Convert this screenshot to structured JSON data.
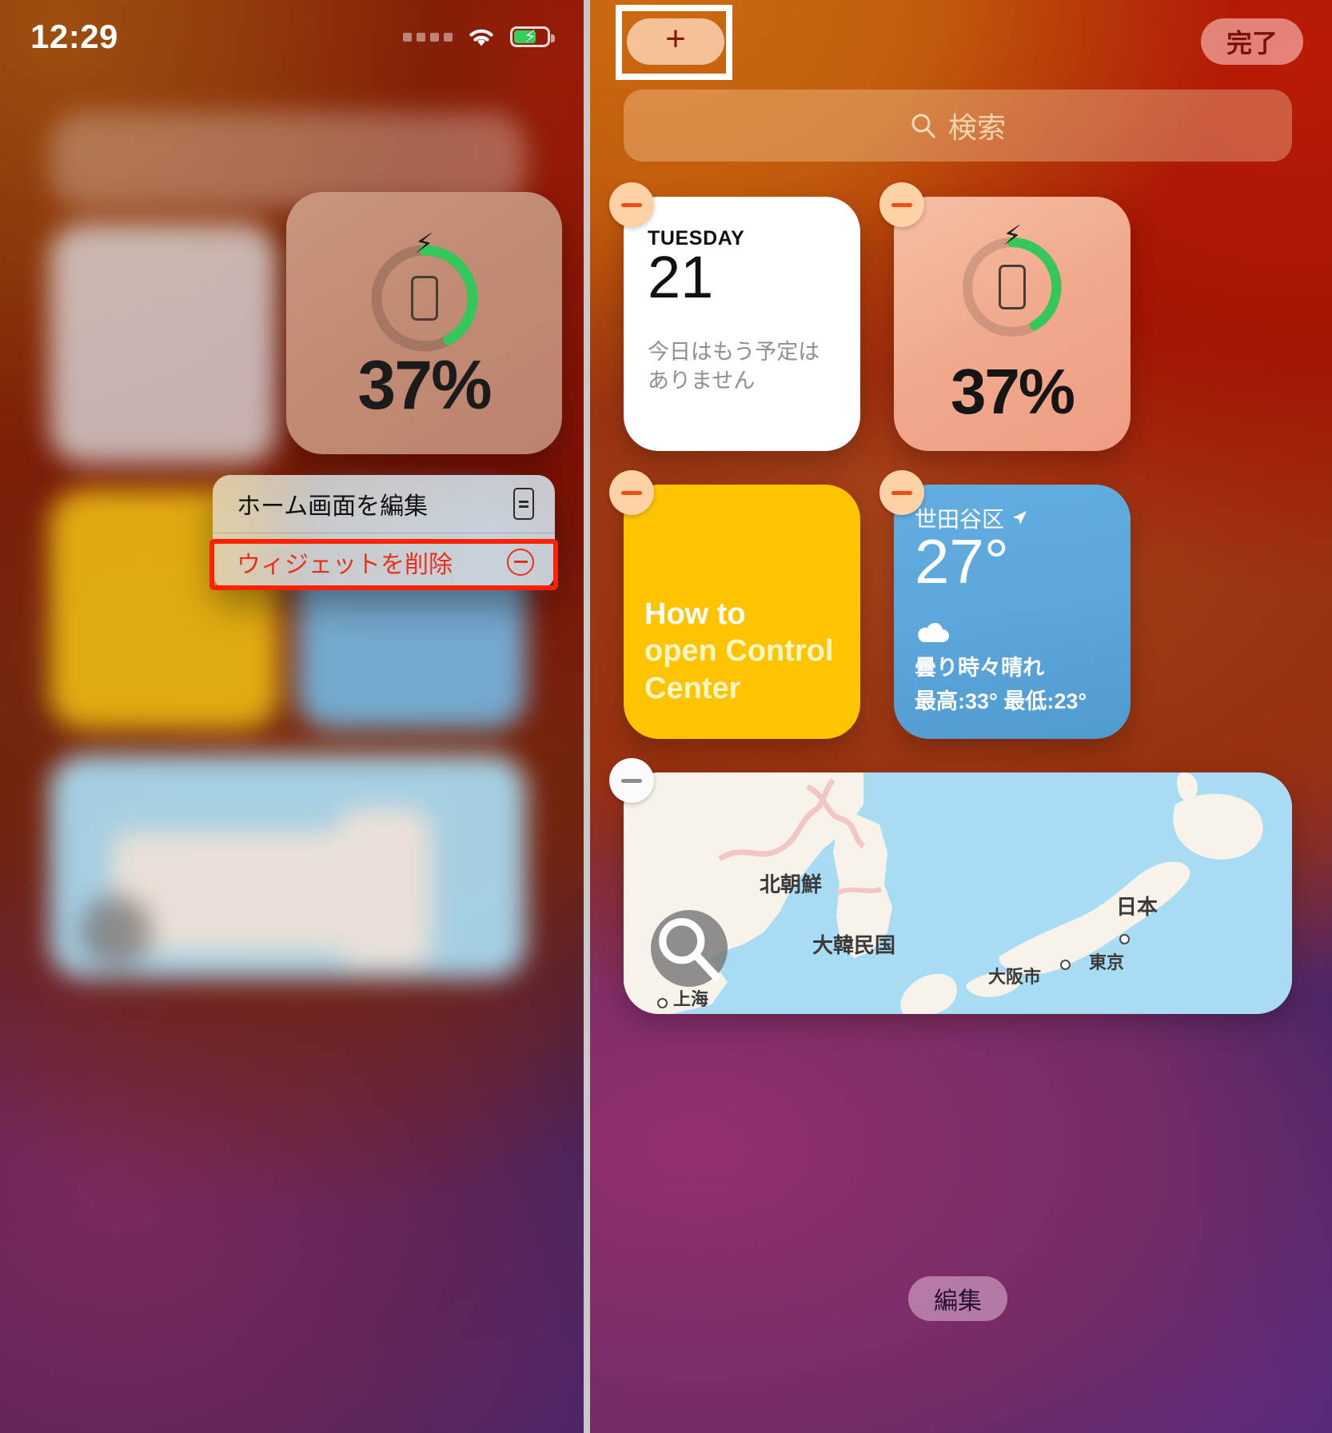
{
  "left": {
    "status": {
      "time": "12:29",
      "wifi_icon": "wifi-icon",
      "battery_icon": "battery-charging-icon",
      "signal_icon": "signal-dots-icon"
    },
    "battery_widget": {
      "percent": "37%",
      "icon": "battery-ring-iphone-icon"
    },
    "context_menu": {
      "items": [
        {
          "label": "ホーム画面を編集",
          "icon": "remote-control-icon",
          "destructive": false
        },
        {
          "label": "ウィジェットを削除",
          "icon": "minus-circle-icon",
          "destructive": true
        }
      ]
    },
    "highlight": {
      "color": "#ff2200"
    }
  },
  "right": {
    "topbar": {
      "add_label": "+",
      "done_label": "完了",
      "highlight_color": "#ffffff"
    },
    "search": {
      "placeholder": "検索",
      "icon": "search-icon"
    },
    "widgets": [
      {
        "type": "calendar",
        "remove_icon": "minus-badge-icon",
        "weekday": "TUESDAY",
        "day": "21",
        "note": "今日はもう予定はありません"
      },
      {
        "type": "battery",
        "remove_icon": "minus-badge-icon",
        "percent": "37%",
        "icon": "battery-ring-iphone-icon"
      },
      {
        "type": "howto",
        "remove_icon": "minus-badge-icon",
        "line1": "How to",
        "line2": "open Control",
        "line3": "Center",
        "bg": "#ffc400"
      },
      {
        "type": "weather",
        "remove_icon": "minus-badge-icon",
        "location": "世田谷区",
        "location_icon": "location-arrow-icon",
        "temp": "27°",
        "condition_icon": "cloud-icon",
        "condition": "曇り時々晴れ",
        "hilo": "最高:33° 最低:23°"
      },
      {
        "type": "map",
        "remove_icon": "minus-badge-icon",
        "search_icon": "search-icon",
        "labels": [
          "北朝鮮",
          "日本",
          "大韓民国",
          "大阪市",
          "東京",
          "上海"
        ]
      }
    ],
    "edit_button": {
      "label": "編集"
    }
  }
}
